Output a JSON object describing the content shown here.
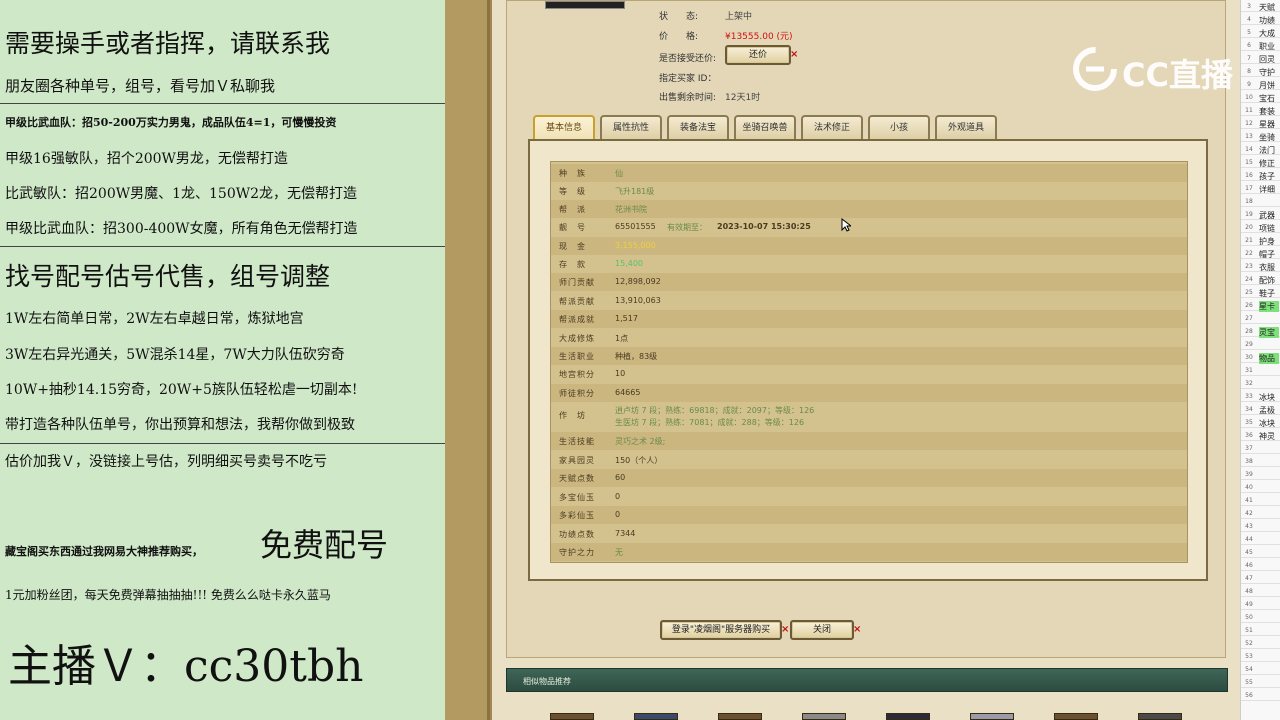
{
  "left": {
    "lines": [
      "需要操手或者指挥，请联系我",
      "朋友圈各种单号，组号，看号加Ｖ私聊我",
      "甲级比武血队：招50-200万实力男鬼，成品队伍4=1，可慢慢投资",
      "甲级16强敏队，招个200W男龙，无偿帮打造",
      "比武敏队：招200W男魔、1龙、150W2龙，无偿帮打造",
      "甲级比武血队：招300-400W女魔，所有角色无偿帮打造",
      "找号配号估号代售，组号调整",
      "1W左右简单日常，2W左右卓越日常，炼狱地宫",
      "3W左右异光通关，5W混杀14星，7W大力队伍砍穷奇",
      "10W+抽秒14.15穷奇，20W+5族队伍轻松虐一切副本!",
      "带打造各种队伍单号，你出预算和想法，我帮你做到极致",
      "估价加我Ｖ，没链接上号估，列明细买号卖号不吃亏",
      "藏宝阁买东西通过我网易大神推荐购买，",
      "免费配号",
      "1元加粉丝团，每天免费弹幕抽抽抽!!! 免费么么哒卡永久蓝马",
      "主播Ｖ：cc30tbh"
    ]
  },
  "info": {
    "status_label": "状　　态:",
    "status_value": "上架中",
    "price_label": "价　　格:",
    "price_value": "¥13555.00 (元)",
    "bargain_label": "是否接受还价:",
    "bargain_button": "还价",
    "buyer_label": "指定买家 ID：",
    "buyer_value": "",
    "remain_label": "出售剩余时间:",
    "remain_value": "12天1时"
  },
  "tabs": [
    "基本信息",
    "属性抗性",
    "装备法宝",
    "坐骑召唤兽",
    "法术修正",
    "小孩",
    "外观道具"
  ],
  "stats": [
    {
      "k": "种　族",
      "v": "仙",
      "c": "#6a8a4a"
    },
    {
      "k": "等　级",
      "v": "飞升181级",
      "c": "#6a8a4a"
    },
    {
      "k": "帮　派",
      "v": "花洲书院",
      "c": "#6a8a4a"
    },
    {
      "k": "靓　号",
      "v": "65501555",
      "v2": "有效期至：",
      "v3": "2023-10-07 15:30:25",
      "c": "#4a3a20"
    },
    {
      "k": "现　金",
      "v": "3,155,000",
      "c": "#f0d040"
    },
    {
      "k": "存　款",
      "v": "15,400",
      "c": "#58c070"
    },
    {
      "k": "师门贡献",
      "v": "12,898,092",
      "c": "#4a3a20"
    },
    {
      "k": "帮派贡献",
      "v": "13,910,063",
      "c": "#4a3a20"
    },
    {
      "k": "帮派成就",
      "v": "1,517",
      "c": "#4a3a20"
    },
    {
      "k": "大成修炼",
      "v": "1点",
      "c": "#4a3a20"
    },
    {
      "k": "生活职业",
      "v": "种植，83级",
      "c": "#4a3a20"
    },
    {
      "k": "地宫积分",
      "v": "10",
      "c": "#4a3a20"
    },
    {
      "k": "师徒积分",
      "v": "64665",
      "c": "#4a3a20"
    },
    {
      "k": "作　坊",
      "v": "逍卢坊 7 段；熟练：69818；成就：2097；等级：126",
      "v2": "生医坊 7 段；熟练：7081；成就：288；等级：126",
      "c": "#6a8a4a"
    },
    {
      "k": "生活技能",
      "v": "灵巧之术 2级;",
      "c": "#6a8a4a"
    },
    {
      "k": "家具园灵",
      "v": "150（个人）",
      "c": "#4a3a20"
    },
    {
      "k": "天赋点数",
      "v": "60",
      "c": "#4a3a20"
    },
    {
      "k": "多宝仙玉",
      "v": "0",
      "c": "#4a3a20"
    },
    {
      "k": "多彩仙玉",
      "v": "0",
      "c": "#4a3a20"
    },
    {
      "k": "功绩点数",
      "v": "7344",
      "c": "#4a3a20"
    },
    {
      "k": "守护之力",
      "v": "无",
      "c": "#6a8a4a"
    }
  ],
  "actions": {
    "buy_button": "登录\"凌烟阁\"服务器购买",
    "close_button": "关闭"
  },
  "recommend": {
    "title": "相似物品推荐"
  },
  "logo": {
    "text": "CC直播"
  },
  "sheet": {
    "rows": [
      {
        "n": "3",
        "t": "天赋"
      },
      {
        "n": "4",
        "t": "功绩"
      },
      {
        "n": "5",
        "t": "大成"
      },
      {
        "n": "6",
        "t": "职业"
      },
      {
        "n": "7",
        "t": "回灵"
      },
      {
        "n": "8",
        "t": "守护"
      },
      {
        "n": "9",
        "t": "月饼"
      },
      {
        "n": "10",
        "t": "宝石"
      },
      {
        "n": "11",
        "t": "套装"
      },
      {
        "n": "12",
        "t": "星器"
      },
      {
        "n": "13",
        "t": "坐骑"
      },
      {
        "n": "14",
        "t": "法门"
      },
      {
        "n": "15",
        "t": "修正"
      },
      {
        "n": "16",
        "t": "孩子"
      },
      {
        "n": "17",
        "t": "详细"
      },
      {
        "n": "18",
        "t": ""
      },
      {
        "n": "19",
        "t": "武器"
      },
      {
        "n": "20",
        "t": "项链"
      },
      {
        "n": "21",
        "t": "护身"
      },
      {
        "n": "22",
        "t": "帽子"
      },
      {
        "n": "23",
        "t": "衣服"
      },
      {
        "n": "24",
        "t": "配饰"
      },
      {
        "n": "25",
        "t": "鞋子"
      },
      {
        "n": "26",
        "t": "星卡",
        "g": true
      },
      {
        "n": "27",
        "t": ""
      },
      {
        "n": "28",
        "t": "灵宝",
        "g": true
      },
      {
        "n": "29",
        "t": ""
      },
      {
        "n": "30",
        "t": "物品",
        "g": true
      },
      {
        "n": "31",
        "t": ""
      },
      {
        "n": "32",
        "t": ""
      },
      {
        "n": "33",
        "t": "冰块"
      },
      {
        "n": "34",
        "t": "孟极"
      },
      {
        "n": "35",
        "t": "冰块"
      },
      {
        "n": "36",
        "t": "神灵"
      },
      {
        "n": "37",
        "t": ""
      },
      {
        "n": "38",
        "t": ""
      },
      {
        "n": "39",
        "t": ""
      },
      {
        "n": "40",
        "t": ""
      },
      {
        "n": "41",
        "t": ""
      },
      {
        "n": "42",
        "t": ""
      },
      {
        "n": "43",
        "t": ""
      },
      {
        "n": "44",
        "t": ""
      },
      {
        "n": "45",
        "t": ""
      },
      {
        "n": "46",
        "t": ""
      },
      {
        "n": "47",
        "t": ""
      },
      {
        "n": "48",
        "t": ""
      },
      {
        "n": "49",
        "t": ""
      },
      {
        "n": "50",
        "t": ""
      },
      {
        "n": "51",
        "t": ""
      },
      {
        "n": "52",
        "t": ""
      },
      {
        "n": "53",
        "t": ""
      },
      {
        "n": "54",
        "t": ""
      },
      {
        "n": "55",
        "t": ""
      },
      {
        "n": "56",
        "t": ""
      }
    ]
  }
}
